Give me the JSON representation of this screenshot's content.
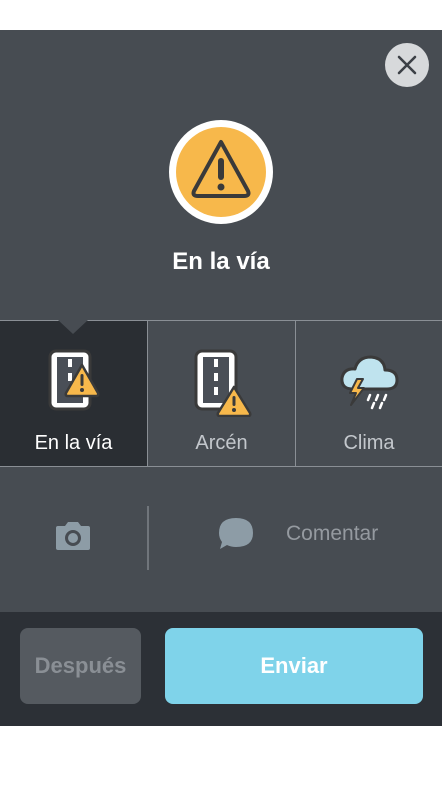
{
  "header": {
    "title": "En la vía",
    "close_icon": "close-icon",
    "hero_icon": "warning-icon"
  },
  "categories": [
    {
      "label": "En la vía",
      "icon": "road-hazard-icon",
      "selected": true
    },
    {
      "label": "Arcén",
      "icon": "shoulder-hazard-icon",
      "selected": false
    },
    {
      "label": "Clima",
      "icon": "storm-cloud-icon",
      "selected": false
    }
  ],
  "actions": {
    "camera_icon": "camera-icon",
    "comment_label": "Comentar",
    "comment_icon": "speech-bubble-icon"
  },
  "buttons": {
    "later_label": "Después",
    "send_label": "Enviar"
  },
  "colors": {
    "panel": "#474c52",
    "selected": "#2a2e33",
    "send": "#7fd3ea",
    "warning": "#f7b84b",
    "bottom_bar": "#2c3036"
  }
}
